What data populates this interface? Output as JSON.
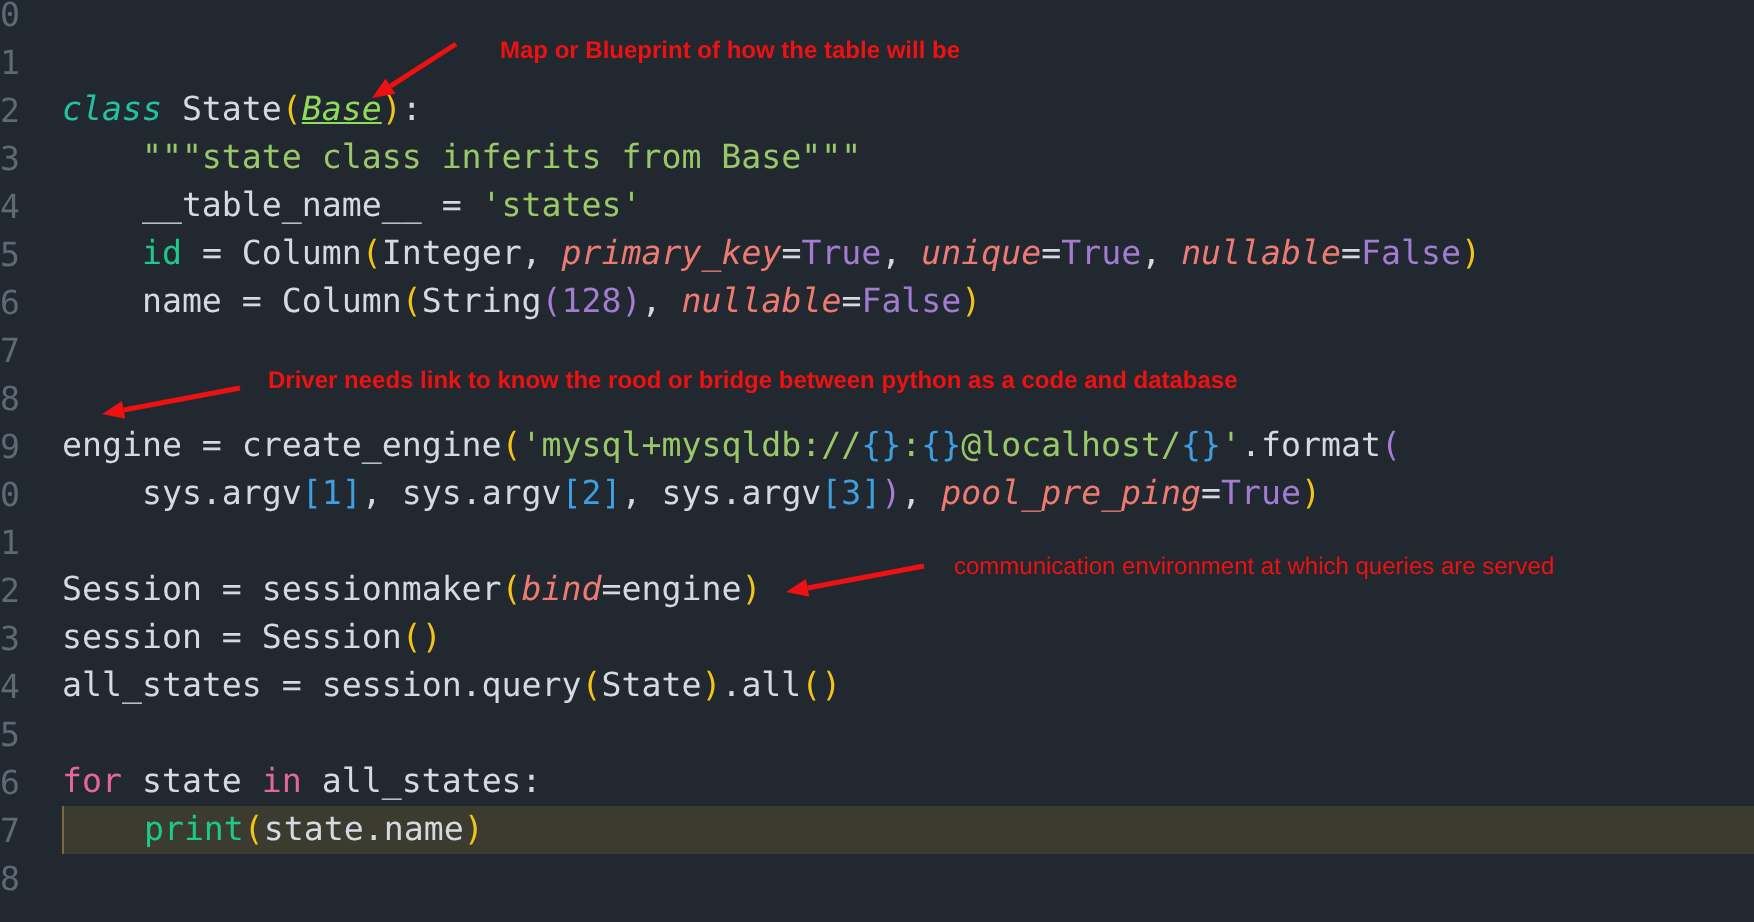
{
  "editor": {
    "lines": [
      {
        "number": "0",
        "current": false
      },
      {
        "number": "1",
        "current": false
      },
      {
        "number": "2",
        "current": false,
        "tokens": [
          {
            "text": "class",
            "kind": "keyword"
          },
          {
            "text": " State",
            "kind": "plain"
          },
          {
            "text": "(",
            "kind": "bracket1"
          },
          {
            "text": "Base",
            "kind": "class-name"
          },
          {
            "text": ")",
            "kind": "bracket1"
          },
          {
            "text": ":",
            "kind": "plain"
          }
        ]
      },
      {
        "number": "3",
        "current": false,
        "tokens": [
          {
            "text": "    \"\"\"state class inferits from Base\"\"\"",
            "kind": "string"
          }
        ]
      },
      {
        "number": "4",
        "current": false,
        "tokens": [
          {
            "text": "    __table_name__ = ",
            "kind": "plain"
          },
          {
            "text": "'states'",
            "kind": "string"
          }
        ]
      },
      {
        "number": "5",
        "current": false,
        "tokens": [
          {
            "text": "    id",
            "kind": "builtin"
          },
          {
            "text": " = Column",
            "kind": "plain"
          },
          {
            "text": "(",
            "kind": "bracket1"
          },
          {
            "text": "Integer, ",
            "kind": "plain"
          },
          {
            "text": "primary_key",
            "kind": "param"
          },
          {
            "text": "=",
            "kind": "plain"
          },
          {
            "text": "True",
            "kind": "constant"
          },
          {
            "text": ", ",
            "kind": "plain"
          },
          {
            "text": "unique",
            "kind": "param"
          },
          {
            "text": "=",
            "kind": "plain"
          },
          {
            "text": "True",
            "kind": "constant"
          },
          {
            "text": ", ",
            "kind": "plain"
          },
          {
            "text": "nullable",
            "kind": "param"
          },
          {
            "text": "=",
            "kind": "plain"
          },
          {
            "text": "False",
            "kind": "constant"
          },
          {
            "text": ")",
            "kind": "bracket1"
          }
        ]
      },
      {
        "number": "6",
        "current": false,
        "tokens": [
          {
            "text": "    name = Column",
            "kind": "plain"
          },
          {
            "text": "(",
            "kind": "bracket1"
          },
          {
            "text": "String",
            "kind": "plain"
          },
          {
            "text": "(",
            "kind": "bracket2"
          },
          {
            "text": "128",
            "kind": "constant"
          },
          {
            "text": ")",
            "kind": "bracket2"
          },
          {
            "text": ", ",
            "kind": "plain"
          },
          {
            "text": "nullable",
            "kind": "param"
          },
          {
            "text": "=",
            "kind": "plain"
          },
          {
            "text": "False",
            "kind": "constant"
          },
          {
            "text": ")",
            "kind": "bracket1"
          }
        ]
      },
      {
        "number": "7",
        "current": false
      },
      {
        "number": "8",
        "current": false
      },
      {
        "number": "9",
        "current": false,
        "tokens": [
          {
            "text": "engine = create_engine",
            "kind": "plain"
          },
          {
            "text": "(",
            "kind": "bracket1"
          },
          {
            "text": "'mysql+mysqldb://",
            "kind": "string"
          },
          {
            "text": "{}",
            "kind": "bracket3"
          },
          {
            "text": ":",
            "kind": "string"
          },
          {
            "text": "{}",
            "kind": "bracket3"
          },
          {
            "text": "@localhost/",
            "kind": "string"
          },
          {
            "text": "{}",
            "kind": "bracket3"
          },
          {
            "text": "'",
            "kind": "string"
          },
          {
            "text": ".format",
            "kind": "plain"
          },
          {
            "text": "(",
            "kind": "bracket2"
          }
        ]
      },
      {
        "number": "0",
        "current": false,
        "tokens": [
          {
            "text": "    sys.argv",
            "kind": "plain"
          },
          {
            "text": "[1]",
            "kind": "bracket3"
          },
          {
            "text": ", sys.argv",
            "kind": "plain"
          },
          {
            "text": "[2]",
            "kind": "bracket3"
          },
          {
            "text": ", sys.argv",
            "kind": "plain"
          },
          {
            "text": "[3]",
            "kind": "bracket3"
          },
          {
            "text": ")",
            "kind": "bracket2"
          },
          {
            "text": ", ",
            "kind": "plain"
          },
          {
            "text": "pool_pre_ping",
            "kind": "param"
          },
          {
            "text": "=",
            "kind": "plain"
          },
          {
            "text": "True",
            "kind": "constant"
          },
          {
            "text": ")",
            "kind": "bracket1"
          }
        ]
      },
      {
        "number": "1",
        "current": false
      },
      {
        "number": "2",
        "current": false,
        "tokens": [
          {
            "text": "Session = sessionmaker",
            "kind": "plain"
          },
          {
            "text": "(",
            "kind": "bracket1"
          },
          {
            "text": "bind",
            "kind": "param"
          },
          {
            "text": "=",
            "kind": "plain"
          },
          {
            "text": "engine",
            "kind": "plain"
          },
          {
            "text": ")",
            "kind": "bracket1"
          }
        ]
      },
      {
        "number": "3",
        "current": false,
        "tokens": [
          {
            "text": "session = Session",
            "kind": "plain"
          },
          {
            "text": "()",
            "kind": "bracket1"
          }
        ]
      },
      {
        "number": "4",
        "current": false,
        "tokens": [
          {
            "text": "all_states = session.query",
            "kind": "plain"
          },
          {
            "text": "(",
            "kind": "bracket1"
          },
          {
            "text": "State",
            "kind": "plain"
          },
          {
            "text": ")",
            "kind": "bracket1"
          },
          {
            "text": ".all",
            "kind": "plain"
          },
          {
            "text": "()",
            "kind": "bracket1"
          }
        ]
      },
      {
        "number": "5",
        "current": false
      },
      {
        "number": "6",
        "current": false,
        "tokens": [
          {
            "text": "for",
            "kind": "control"
          },
          {
            "text": " state ",
            "kind": "plain"
          },
          {
            "text": "in",
            "kind": "control"
          },
          {
            "text": " all_states:",
            "kind": "plain"
          }
        ]
      },
      {
        "number": "7",
        "current": true,
        "tokens": [
          {
            "text": "    print",
            "kind": "builtin"
          },
          {
            "text": "(",
            "kind": "bracket1"
          },
          {
            "text": "state.name",
            "kind": "plain"
          },
          {
            "text": ")",
            "kind": "bracket1"
          }
        ]
      },
      {
        "number": "8",
        "current": false
      }
    ]
  },
  "annotations": [
    {
      "text": "Map or Blueprint of how the table will be"
    },
    {
      "text": "Driver needs link to know the rood or bridge between python as a code and database"
    },
    {
      "text": "communication environment at which queries are served"
    }
  ]
}
